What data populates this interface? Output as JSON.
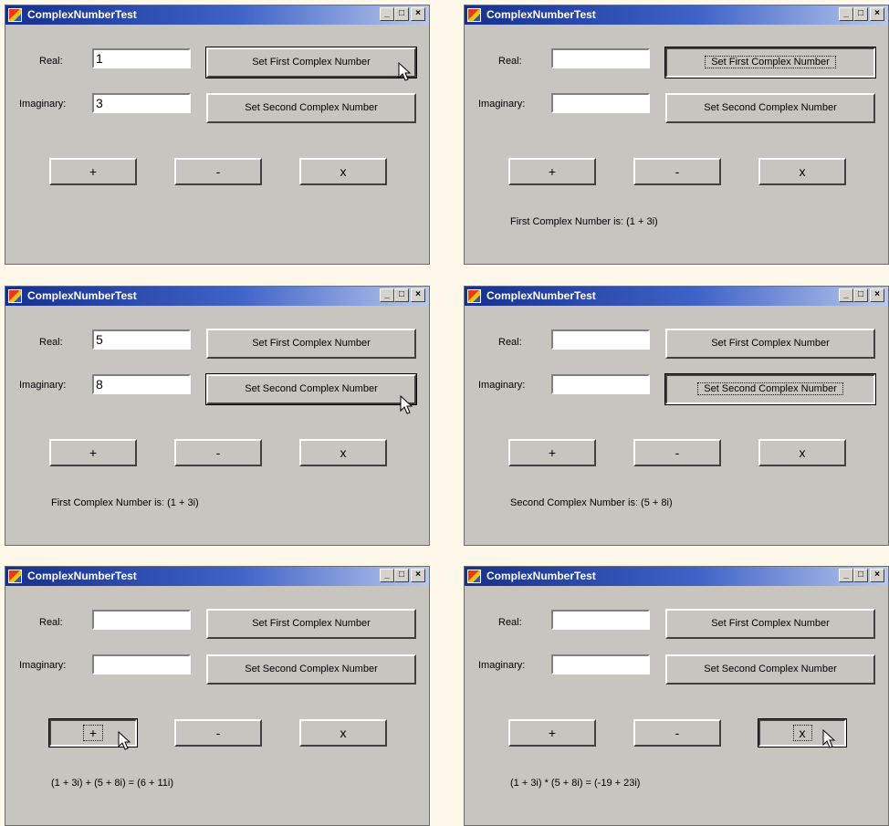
{
  "colors": {
    "page_background": "#fdf8e9",
    "window_face": "#c8c5c1",
    "titlebar_start": "#16308e",
    "titlebar_end": "#b9c9ec"
  },
  "app": {
    "title": "ComplexNumberTest",
    "controls": {
      "minimize": "_",
      "maximize": "□",
      "close": "×"
    },
    "icon": "application-icon"
  },
  "labels": {
    "real": "Real:",
    "imaginary": "Imaginary:",
    "set_first": "Set First Complex Number",
    "set_second": "Set Second Complex Number",
    "add": "+",
    "subtract": "-",
    "multiply": "x"
  },
  "windows": [
    {
      "id": "w1",
      "real_value": "1",
      "imaginary_value": "3",
      "result": "",
      "focused_button": "set-first",
      "pressed_button": "",
      "cursor_icon": "arrow-cursor-icon"
    },
    {
      "id": "w2",
      "real_value": "",
      "imaginary_value": "",
      "result": "First Complex Number is: (1 + 3i)",
      "focused_button": "set-first",
      "pressed_button": "set-first",
      "cursor_icon": ""
    },
    {
      "id": "w3",
      "real_value": "5",
      "imaginary_value": "8",
      "result": "First Complex Number is: (1 + 3i)",
      "focused_button": "set-second",
      "pressed_button": "",
      "cursor_icon": "arrow-cursor-icon"
    },
    {
      "id": "w4",
      "real_value": "",
      "imaginary_value": "",
      "result": "Second Complex Number is: (5 + 8i)",
      "focused_button": "set-second",
      "pressed_button": "set-second",
      "cursor_icon": ""
    },
    {
      "id": "w5",
      "real_value": "",
      "imaginary_value": "",
      "result": "(1 + 3i) + (5 + 8i) = (6 + 11i)",
      "focused_button": "add",
      "pressed_button": "add",
      "cursor_icon": "arrow-cursor-icon"
    },
    {
      "id": "w6",
      "real_value": "",
      "imaginary_value": "",
      "result": "(1 + 3i) * (5 + 8i) = (-19 + 23i)",
      "focused_button": "multiply",
      "pressed_button": "multiply",
      "cursor_icon": "arrow-cursor-icon"
    }
  ]
}
